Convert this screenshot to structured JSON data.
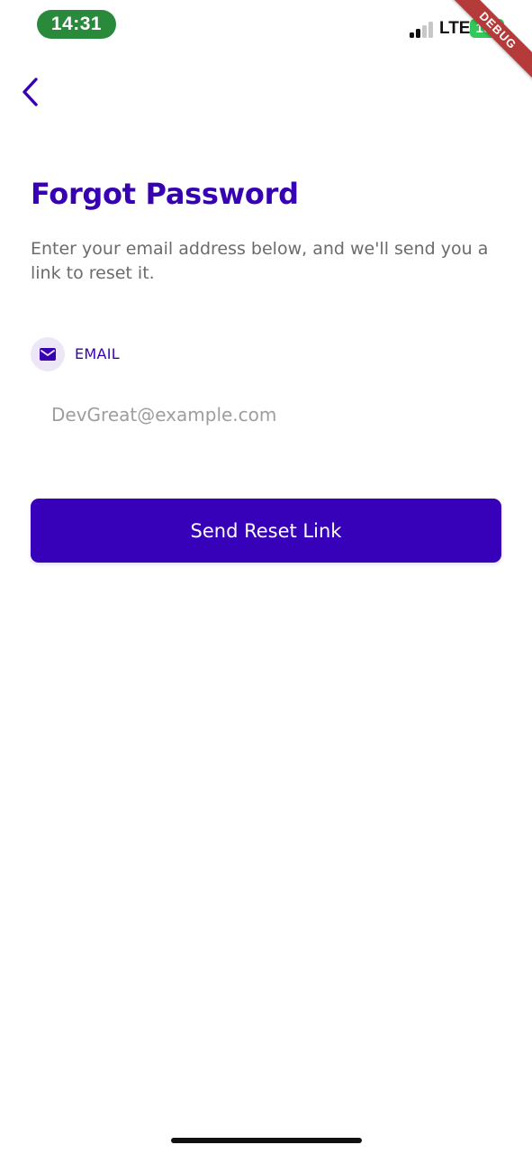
{
  "status_bar": {
    "time": "14:31",
    "network": "LTE",
    "battery": "100"
  },
  "debug_banner": {
    "label": "DEBUG"
  },
  "header": {
    "back_icon": "chevron-left-icon"
  },
  "page": {
    "title": "Forgot Password",
    "subtitle": "Enter your email address below, and we'll send you a link to reset it."
  },
  "form": {
    "email_label": "EMAIL",
    "email_icon": "mail-icon",
    "email_value": "",
    "email_placeholder": "DevGreat@example.com",
    "submit_label": "Send Reset Link"
  },
  "colors": {
    "primary": "#3700b9",
    "title": "#3700b3",
    "text_secondary": "#6b6b6b",
    "icon_bg": "#ece6f7",
    "time_pill": "#2a8a3c",
    "battery": "#34c759",
    "debug": "#b53a3a"
  }
}
